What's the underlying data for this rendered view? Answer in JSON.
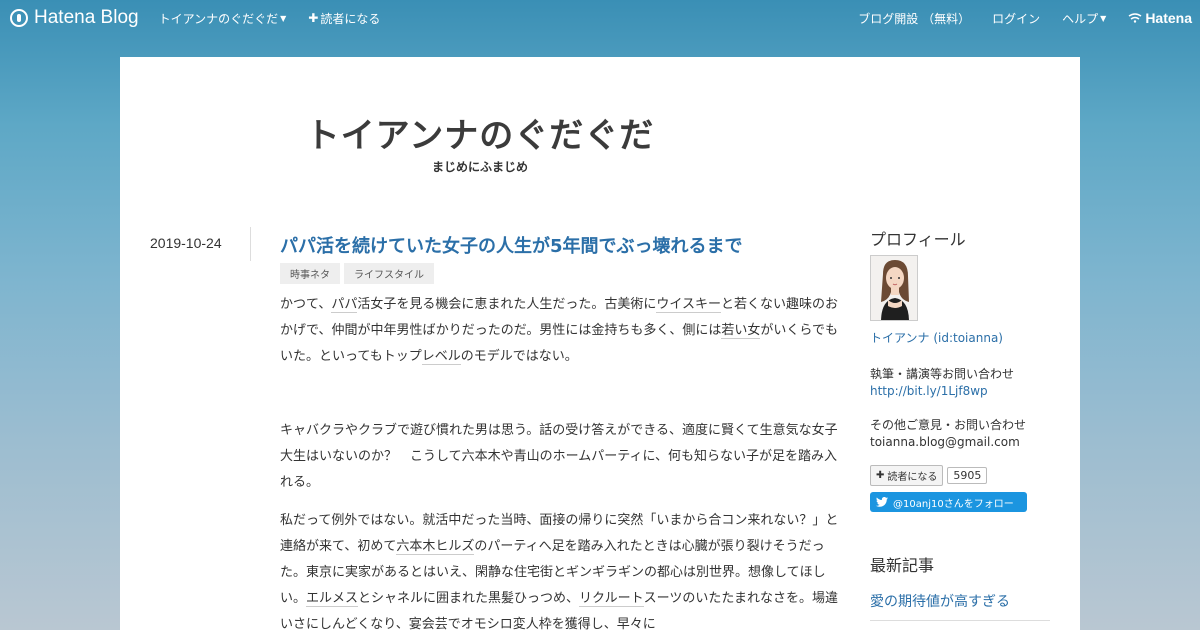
{
  "topbar": {
    "brand": "Hatena Blog",
    "blog_menu": "トイアンナのぐだぐだ",
    "subscribe": "読者になる",
    "open_blog": "ブログ開設 （無料）",
    "login": "ログイン",
    "help": "ヘルプ",
    "hatena": "Hatena"
  },
  "blog": {
    "title": "トイアンナのぐだぐだ",
    "subtitle": "まじめにふまじめ"
  },
  "entry": {
    "date": "2019-10-24",
    "title": "パパ活を続けていた女子の人生が5年間でぶっ壊れるまで",
    "tags": [
      "時事ネタ",
      "ライフスタイル"
    ],
    "p1_a": "かつて、",
    "p1_link1": "パパ",
    "p1_b": "活女子を見る機会に恵まれた人生だった。古美術に",
    "p1_link2": "ウイスキー",
    "p1_c": "と若くない趣味のおかげで、仲間が中年男性ばかりだったのだ。男性には金持ちも多く、側には",
    "p1_link3": "若い女",
    "p1_d": "がいくらでもいた。といってもトップ",
    "p1_link4": "レベル",
    "p1_e": "のモデルではない。",
    "p2": "キャバクラやクラブで遊び慣れた男は思う。話の受け答えができる、適度に賢くて生意気な女子大生はいないのか？　こうして六本木や青山のホームパーティに、何も知らない子が足を踏み入れる。",
    "p3_a": " 私だって例外ではない。就活中だった当時、面接の帰りに突然「いまから合コン来れない？」と連絡が来て、初めて",
    "p3_link1": "六本木ヒルズ",
    "p3_b": "のパーティへ足を踏み入れたときは心臓が張り裂けそうだった。東京に実家があるとはいえ、閑静な住宅街とギンギラギンの都心は別世界。想像してほしい。",
    "p3_link2": "エルメス",
    "p3_c": "とシャネルに囲まれた黒髪ひっつめ、",
    "p3_link3": "リクルート",
    "p3_d": "スーツのいたたまれなさを。場違いさにしんどくなり、宴会芸でオモシロ変人枠を獲得し、早々に"
  },
  "sidebar": {
    "profile_heading": "プロフィール",
    "user_link": "トイアンナ (id:toianna)",
    "contact1_label": "執筆・講演等お問い合わせ",
    "contact1_link": "http://bit.ly/1Ljf8wp",
    "contact2_label": "その他ご意見・お問い合わせ",
    "contact2_email": "toianna.blog@gmail.com",
    "reader_button": "読者になる",
    "reader_count": "5905",
    "twitter_follow": "@10anj10さんをフォロー",
    "recent_heading": "最新記事",
    "recent_item": "愛の期待値が高すぎる"
  },
  "colors": {
    "link": "#2b6fa8",
    "twitter": "#1b95e0"
  }
}
